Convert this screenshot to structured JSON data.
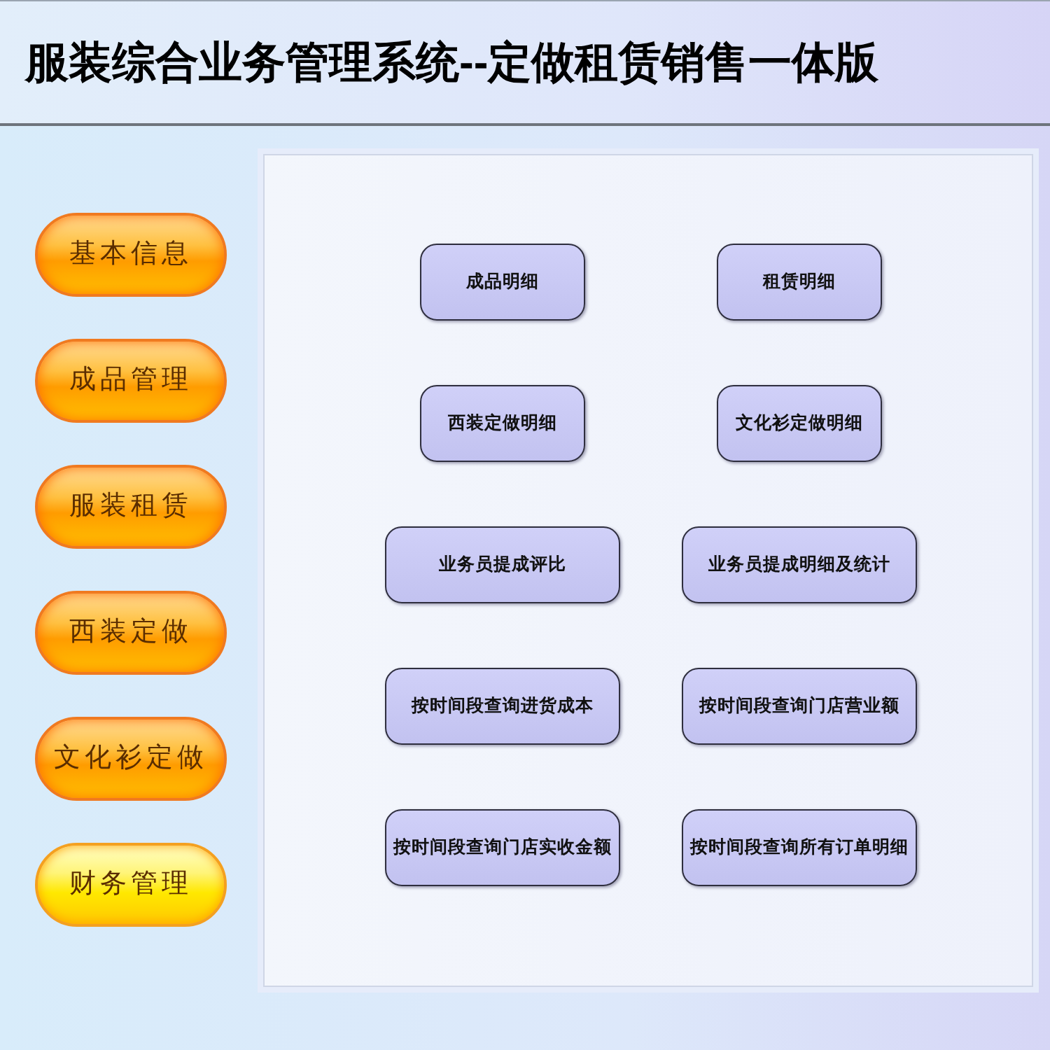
{
  "window": {
    "title": "服装综合业务管理系统--定做租赁销售一体版"
  },
  "sidebar": {
    "items": [
      {
        "label": "基本信息",
        "selected": false
      },
      {
        "label": "成品管理",
        "selected": false
      },
      {
        "label": "服装租赁",
        "selected": false
      },
      {
        "label": "西装定做",
        "selected": false
      },
      {
        "label": "文化衫定做",
        "selected": false
      },
      {
        "label": "财务管理",
        "selected": true
      }
    ]
  },
  "panel": {
    "buttons": [
      "成品明细",
      "租赁明细",
      "西装定做明细",
      "文化衫定做明细",
      "业务员提成评比",
      "业务员提成明细及统计",
      "按时间段查询进货成本",
      "按时间段查询门店营业额",
      "按时间段查询门店实收金额",
      "按时间段查询所有订单明细"
    ]
  }
}
